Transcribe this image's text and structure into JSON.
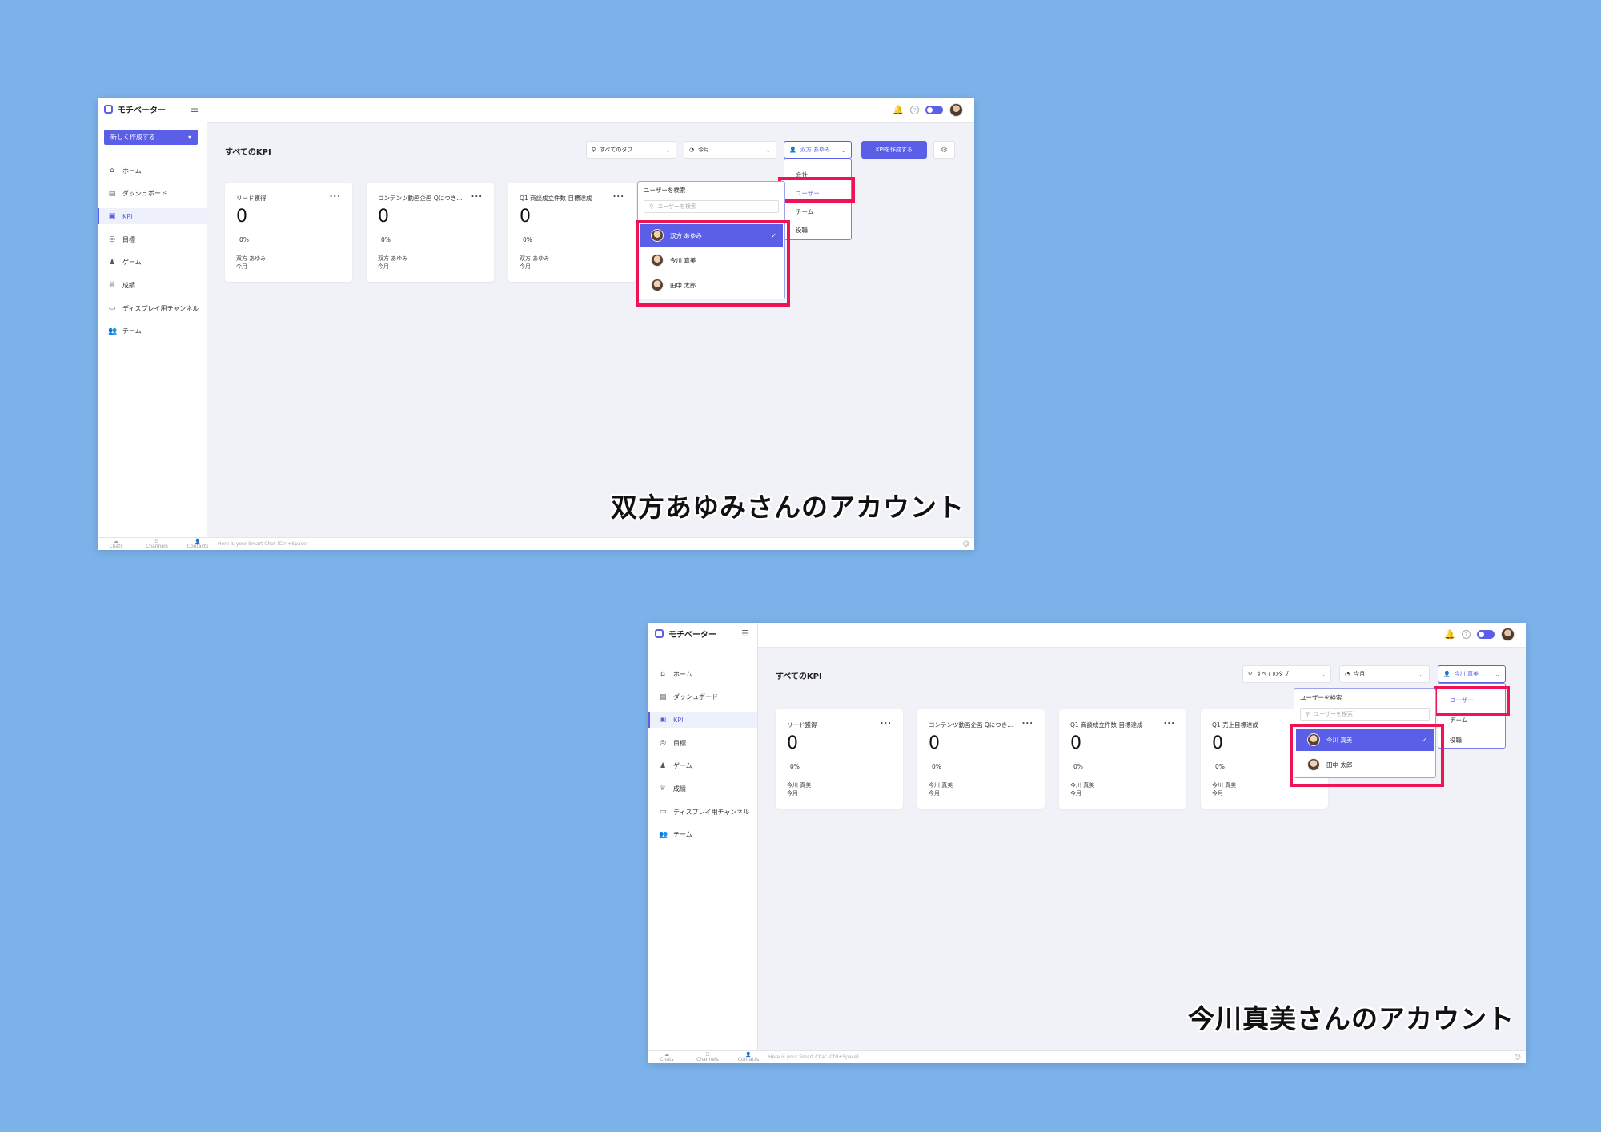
{
  "colors": {
    "background": "#7cb2ea",
    "accent": "#5b5fe8",
    "highlight": "#ef1356"
  },
  "common": {
    "app_name": "モチベーター",
    "create_new_label": "新しく作成する",
    "nav": [
      "ホーム",
      "ダッシュボード",
      "KPI",
      "目標",
      "ゲーム",
      "成績",
      "ディスプレイ用チャンネル",
      "チーム"
    ],
    "page_title": "すべてのKPI",
    "filter_tabs": "すべてのタブ",
    "filter_period": "今月",
    "kpi_create_label": "KPIを作成する",
    "user_search_title": "ユーザーを検索",
    "user_search_placeholder": "ユーザーを検索",
    "bottom_nav": [
      "Chats",
      "Channels",
      "Contacts"
    ],
    "chat_placeholder": "Here is your Smart Chat (Ctrl+Space)",
    "card_value": "0",
    "card_pct": "0%",
    "card_period": "今月",
    "card_menu": "..."
  },
  "shot_a": {
    "user_filter": "双方 あゆみ",
    "scope_options": [
      "会社",
      "ユーザー",
      "チーム",
      "役職"
    ],
    "cards": [
      {
        "title": "リード獲得",
        "owner": "双方 あゆみ"
      },
      {
        "title": "コンテンツ動画企画 Qにつき...",
        "owner": "双方 あゆみ"
      },
      {
        "title": "Q1 商談成立件数 目標達成",
        "owner": "双方 あゆみ"
      }
    ],
    "users": [
      "双方 あゆみ",
      "今川 真美",
      "田中 太郎"
    ],
    "caption": "双方あゆみさんのアカウント"
  },
  "shot_b": {
    "user_filter": "今川 真美",
    "scope_options": [
      "ユーザー",
      "チーム",
      "役職"
    ],
    "cards": [
      {
        "title": "リード獲得",
        "owner": "今川 真美"
      },
      {
        "title": "コンテンツ動画企画 Qにつき...",
        "owner": "今川 真美"
      },
      {
        "title": "Q1 商談成立件数 目標達成",
        "owner": "今川 真美"
      },
      {
        "title": "Q1 売上目標達成",
        "owner": "今川 真美"
      }
    ],
    "users": [
      "今川 真美",
      "田中 太郎"
    ],
    "caption": "今川真美さんのアカウント"
  }
}
